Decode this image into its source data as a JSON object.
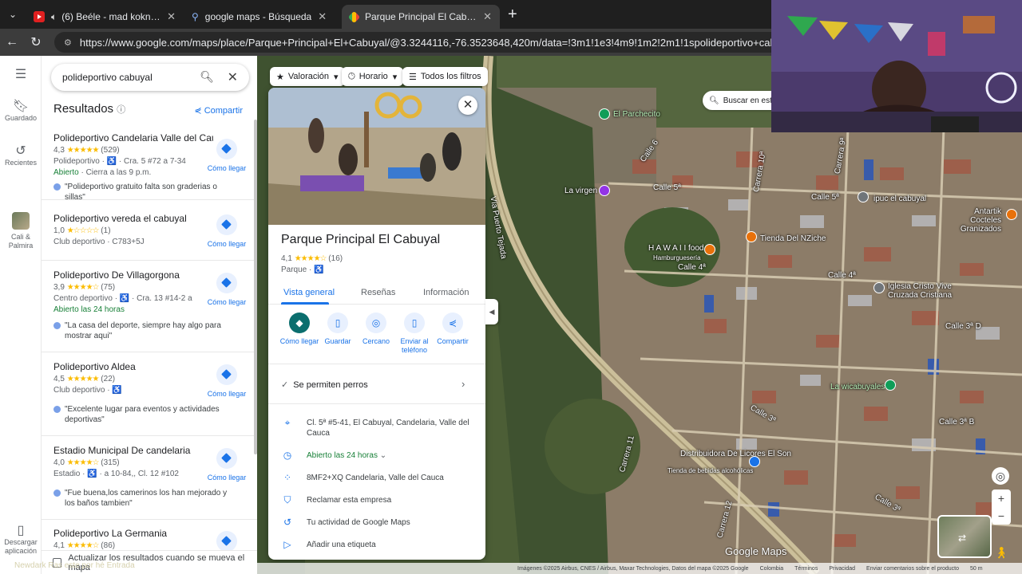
{
  "browser": {
    "tabs": [
      {
        "title": "(6) Beéle - mad koknut (Perfor",
        "close": "✕"
      },
      {
        "title": "google maps - Búsqueda",
        "close": "✕"
      },
      {
        "title": "Parque Principal El Cabuyal - Goo",
        "close": "✕"
      }
    ],
    "new_tab": "+",
    "url": "https://www.google.com/maps/place/Parque+Principal+El+Cabuyal/@3.3244116,-76.3523648,420m/data=!3m1!1e3!4m9!1m2!2m1!1spolideportivo+cabuyal!3m5!1s0x8e3"
  },
  "rail": {
    "menu_icon": "menu-icon",
    "saved": "Guardado",
    "recent": "Recientes",
    "recent_place": "Cali & Palmira",
    "download": "Descargar aplicación"
  },
  "search": {
    "query": "polideportivo cabuyal"
  },
  "results": {
    "heading": "Resultados",
    "share": "Compartir",
    "directions_label": "Cómo llegar",
    "items": [
      {
        "name": "Polideportivo Candelaria Valle del Cauca",
        "rating": "4,3",
        "stars": "★★★★★",
        "count": "(529)",
        "category": "Polideportivo · ♿ · Cra. 5 #72 a 7-34",
        "open": "Abierto",
        "open_rest": " · Cierra a las 9 p.m.",
        "review": "\"Polideportivo gratuito falta son graderias o sillas\""
      },
      {
        "name": "Polideportivo vereda el cabuyal",
        "rating": "1,0",
        "stars": "★☆☆☆☆",
        "count": "(1)",
        "category": "Club deportivo · C783+5J",
        "open": "",
        "open_rest": "",
        "review": ""
      },
      {
        "name": "Polideportivo De Villagorgona",
        "rating": "3,9",
        "stars": "★★★★☆",
        "count": "(75)",
        "category": "Centro deportivo · ♿ · Cra. 13 #14-2 a",
        "open": "Abierto las 24 horas",
        "open_rest": "",
        "review": "\"La casa del deporte, siempre hay algo para mostrar aqui\""
      },
      {
        "name": "Polideportivo Aldea",
        "rating": "4,5",
        "stars": "★★★★★",
        "count": "(22)",
        "category": "Club deportivo · ♿",
        "open": "",
        "open_rest": "",
        "review": "\"Excelente lugar para eventos y actividades deportivas\""
      },
      {
        "name": "Estadio Municipal De candelaria",
        "rating": "4,0",
        "stars": "★★★★☆",
        "count": "(315)",
        "category": "Estadio · ♿ · a 10-84,, Cl. 12 #102",
        "open": "",
        "open_rest": "",
        "review": "\"Fue buena,los camerinos los han mejorado y los baños tambien\""
      },
      {
        "name": "Polideportivo La Germania",
        "rating": "4,1",
        "stars": "★★★★☆",
        "count": "(86)",
        "category": "",
        "open": "",
        "open_rest": "",
        "review": ""
      }
    ],
    "update_toggle": "Actualizar los resultados cuando se mueva el mapa"
  },
  "filters": {
    "rating": "Valoración",
    "hours": "Horario",
    "all": "Todos los filtros"
  },
  "search_area": "Buscar en esta zona",
  "place": {
    "title": "Parque Principal El Cabuyal",
    "rating": "4,1",
    "stars": "★★★★☆",
    "count": "(16)",
    "type": "Parque · ♿",
    "tabs": [
      "Vista general",
      "Reseñas",
      "Información"
    ],
    "actions": [
      "Cómo llegar",
      "Guardar",
      "Cercano",
      "Enviar al teléfono",
      "Compartir"
    ],
    "pets": "Se permiten perros",
    "address": "Cl. 5ª #5-41, El Cabuyal, Candelaria, Valle del Cauca",
    "hours": "Abierto las 24 horas",
    "plus_code": "8MF2+XQ Candelaria, Valle del Cauca",
    "claim": "Reclamar esta empresa",
    "activity": "Tu actividad de Google Maps",
    "label": "Añadir una etiqueta"
  },
  "map": {
    "labels": {
      "parchecito": "El Parchecito",
      "virgen": "La virgen",
      "calle5a": "Calle 5ª",
      "calle5": "Calle 5ª",
      "ipuc": "ipuc el cabuyal",
      "antartik": "Antartik Cocteles Granizados",
      "nziche": "Tienda Del NZiche",
      "hawaii": "H A W A I I food",
      "hamburgueseria": "Hamburguesería",
      "calle4": "Calle 4ª",
      "calle4b": "Calle 4ª",
      "iglesia": "Iglesia Cristo Vive Cruzada Cristiana",
      "calle3d": "Calle 3ª D",
      "wicabuyales": "La wicabuyales",
      "calle3b": "Calle 3ª B",
      "calle3a": "Calle 3ª",
      "calle3": "Calle 3ª",
      "calle6": "Calle 6",
      "carrera9": "Carrera 9ª",
      "carrera10": "Carrera 10ª",
      "carrera11": "Carrera 11",
      "carrera12": "Carrera 12",
      "puerto_tejada": "Vía Puerto Tejada",
      "distribuidora": "Distribuidora De Licores El Son",
      "tienda_bebidas": "Tienda de bebidas alcohólicas"
    },
    "logo": "Google Maps",
    "footer": [
      "Imágenes ©2025 Airbus, CNES / Airbus, Maxar Technologies, Datos del mapa ©2025 Google",
      "Colombia",
      "Términos",
      "Privacidad",
      "Enviar comentarios sobre el producto",
      "50 m"
    ]
  },
  "watermark": "Newdark Ras este por hé Entrada"
}
